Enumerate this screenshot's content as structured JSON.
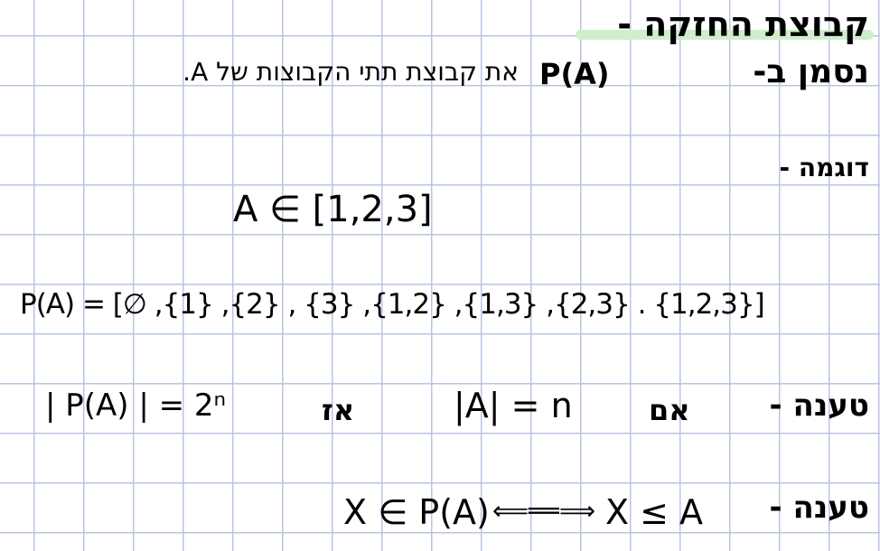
{
  "title": "קבוצת החזקה -",
  "definition": {
    "text": "נסמן ב-",
    "symbol": "P(A)",
    "rest": "את קבוצת תתי הקבוצות של A."
  },
  "example_label": "דוגמה -",
  "set_a": "A ∈ [1,2,3]",
  "power_set": "P(A) = [∅ ,{1} ,{2} , {3} ,{1,2} ,{1,3} ,{2,3} . {1,2,3}]",
  "claim1": {
    "label": "טענה -",
    "if": "אם",
    "cond": "|A| = n",
    "then": "אז",
    "result": "| P(A) | = 2ⁿ"
  },
  "claim2": {
    "label": "טענה -",
    "left": "X ≤ A",
    "arrow": "⟸══⟹",
    "right": "X ∈ P(A)"
  },
  "highlight_color": "#cfeecb"
}
